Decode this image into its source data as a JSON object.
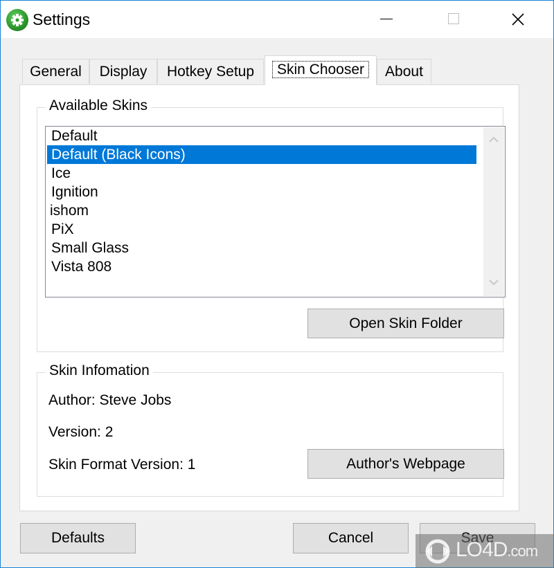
{
  "window": {
    "title": "Settings",
    "app_icon": "gear-icon",
    "controls": {
      "minimize": "minimize-icon",
      "maximize": "maximize-icon",
      "close": "close-icon"
    }
  },
  "tabs": [
    {
      "label": "General",
      "active": false
    },
    {
      "label": "Display",
      "active": false
    },
    {
      "label": "Hotkey Setup",
      "active": false
    },
    {
      "label": "Skin Chooser",
      "active": true
    },
    {
      "label": "About",
      "active": false
    }
  ],
  "available_skins": {
    "legend": "Available Skins",
    "items": [
      "Default",
      "Default (Black Icons)",
      "Ice",
      "Ignition",
      "ishom",
      "PiX",
      "Small Glass",
      "Vista 808"
    ],
    "selected": "Default (Black Icons)",
    "open_folder_label": "Open Skin Folder"
  },
  "skin_information": {
    "legend": "Skin Infomation",
    "author": "Author: Steve Jobs",
    "version": "Version: 2",
    "format_version": "Skin Format Version: 1",
    "webpage_label": "Author's Webpage"
  },
  "footer": {
    "defaults_label": "Defaults",
    "cancel_label": "Cancel",
    "save_label": "Save"
  },
  "watermark": {
    "brand": "LO4D",
    "suffix": ".com"
  },
  "colors": {
    "selection": "#0078d7",
    "window_border": "#1883d7",
    "button_bg": "#e1e1e1"
  }
}
